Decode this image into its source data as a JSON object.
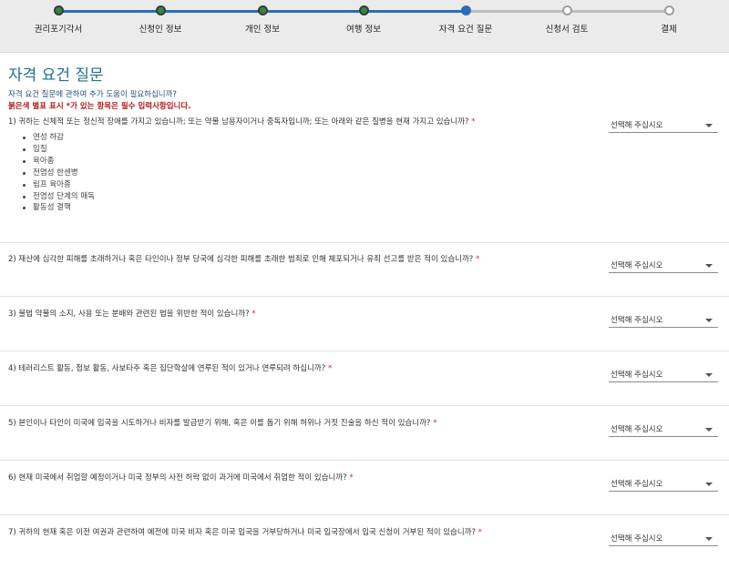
{
  "stepper": {
    "steps": [
      {
        "label": "권리포기각서",
        "state": "done"
      },
      {
        "label": "신청인 정보",
        "state": "done"
      },
      {
        "label": "개인 정보",
        "state": "done"
      },
      {
        "label": "여행 정보",
        "state": "done"
      },
      {
        "label": "자격 요건 질문",
        "state": "current"
      },
      {
        "label": "신청서 검토",
        "state": "todo"
      },
      {
        "label": "결제",
        "state": "todo"
      }
    ],
    "colors": {
      "done": "#2e8b3e",
      "current": "#2a6db5",
      "todo": "#ffffff",
      "track_done": "#2a6db5",
      "track_todo": "#bdbdbd"
    }
  },
  "page": {
    "title": "자격 요건 질문",
    "help_text": "자격 요건 질문에 관하여 추가 도움이 필요하십니까?",
    "required_note": "붉은색 별표 표시 *가 있는 항목은 필수 입력사항입니다."
  },
  "questions": [
    {
      "text": "1) 귀하는 신체적 또는 정신적 장애를 가지고 있습니까; 또는 약물 남용자이거나 중독자입니까; 또는 아래와 같은 질병을 현재 가지고 있습니까?",
      "required_mark": "*",
      "subitems": [
        "연성 하감",
        "임질",
        "육아종",
        "전염성 한센병",
        "림프 육아종",
        "전염성 단계의 매독",
        "활동성 결핵"
      ],
      "select_value": "선택해 주십시오"
    },
    {
      "text": "2) 재산에 심각한 피해를 초래하거나 혹은 타인이나 정부 당국에 심각한 피해를 초래한 범죄로 인해 체포되거나 유죄 선고를 받은 적이 있습니까?",
      "required_mark": "*",
      "select_value": "선택해 주십시오"
    },
    {
      "text": "3) 불법 약물의 소지, 사용 또는 분배와 관련된 법을 위반한 적이 있습니까?",
      "required_mark": "*",
      "select_value": "선택해 주십시오"
    },
    {
      "text": "4) 테러리스트 활동, 첩보 활동, 사보타주 혹은 집단학살에 연루된 적이 있거나 연루되려 하십니까?",
      "required_mark": "*",
      "select_value": "선택해 주십시오"
    },
    {
      "text": "5) 본인이나 타인이 미국에 입국을 시도하거나 비자를 발급받기 위해, 혹은 이를 돕기 위해 허위나 거짓 진술을 하신 적이 있습니까?",
      "required_mark": "*",
      "select_value": "선택해 주십시오"
    },
    {
      "text": "6) 현재 미국에서 취업할 예정이거나 미국 정부의 사전 허락 없이 과거에 미국에서 취업한 적이 있습니까?",
      "required_mark": "*",
      "select_value": "선택해 주십시오"
    },
    {
      "text": "7) 귀하의 현재 혹은 이전 여권과 관련하여 예전에 미국 비자 혹은 미국 입국을 거부당하거나 미국 입국장에서 입국 신청이 거부된 적이 있습니까?",
      "required_mark": "*",
      "select_value": "선택해 주십시오"
    }
  ]
}
